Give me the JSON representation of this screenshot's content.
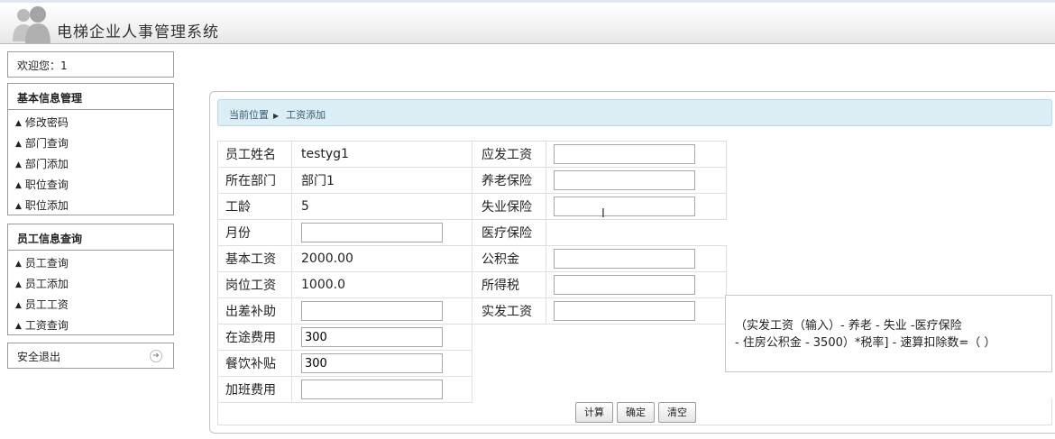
{
  "app": {
    "title": "电梯企业人事管理系统"
  },
  "sidebar": {
    "welcome": "欢迎您：1",
    "groups": [
      {
        "title": "基本信息管理",
        "items": [
          "修改密码",
          "部门查询",
          "部门添加",
          "职位查询",
          "职位添加"
        ]
      },
      {
        "title": "员工信息查询",
        "items": [
          "员工查询",
          "员工添加",
          "员工工资",
          "工资查询"
        ]
      }
    ],
    "logout": "安全退出"
  },
  "breadcrumb": {
    "label": "当前位置",
    "page": "工资添加"
  },
  "form": {
    "left": [
      {
        "label": "员工姓名",
        "value": "testyg1"
      },
      {
        "label": "所在部门",
        "value": "部门1"
      },
      {
        "label": "工龄",
        "value": "5"
      },
      {
        "label": "月份",
        "input": ""
      },
      {
        "label": "基本工资",
        "value": "2000.00"
      },
      {
        "label": "岗位工资",
        "value": "1000.0"
      },
      {
        "label": "出差补助",
        "input": ""
      },
      {
        "label": "在途费用",
        "input": "300"
      },
      {
        "label": "餐饮补贴",
        "input": "300"
      },
      {
        "label": "加班费用",
        "input": ""
      }
    ],
    "right": [
      {
        "label": "应发工资",
        "input": ""
      },
      {
        "label": "养老保险",
        "input": ""
      },
      {
        "label": "失业保险",
        "input": ""
      },
      {
        "label": "医疗保险",
        "input": ""
      },
      {
        "label": "公积金",
        "input": ""
      },
      {
        "label": "所得税",
        "input": ""
      },
      {
        "label": "实发工资",
        "input": ""
      }
    ],
    "formula_line1": "（实发工资（输入）- 养老 - 失业 -医疗保险",
    "formula_line2": "- 住房公积金 - 3500）*税率] - 速算扣除数=（ ）"
  },
  "buttons": {
    "calculate": "计算",
    "confirm": "确定",
    "clear": "清空"
  }
}
